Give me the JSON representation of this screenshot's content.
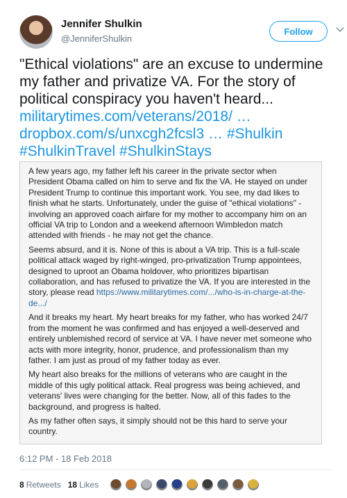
{
  "user": {
    "name": "Jennifer Shulkin",
    "handle": "@JenniferShulkin"
  },
  "follow_label": "Follow",
  "tweet": {
    "text_before": "\"Ethical violations\" are an excuse to undermine my father and privatize VA. For the story of political conspiracy you haven't heard... ",
    "link1": "militarytimes.com/veterans/2018/ …",
    "link2": "dropbox.com/s/unxcgh2fcsl3 …",
    "hashtag1": "#Shulkin",
    "hashtag2": "#ShulkinTravel",
    "hashtag3": "#ShulkinStays"
  },
  "card": {
    "p1": "A few years ago, my father left his career in the private sector when President Obama called on him to serve and fix the VA. He stayed on under President Trump to continue this important work. You see, my dad likes to finish what he starts. Unfortunately, under the guise of \"ethical violations\" - involving an approved coach airfare for my mother to accompany him on an official VA trip to London and a weekend afternoon Wimbledon match attended with friends - he may not get the chance.",
    "p2": "Seems absurd, and it is. None of this is about a VA trip. This is a full-scale political attack waged by right-winged, pro-privatization Trump appointees, designed to uproot an Obama holdover, who prioritizes bipartisan collaboration, and has refused to privatize the VA. If you are interested in the story, please read ",
    "p2_link": "https://www.militarytimes.com/.../who-is-in-charge-at-the-de.../",
    "p3": "And it breaks my heart. My heart breaks for my father, who has worked 24/7 from the moment he was confirmed and has enjoyed a well-deserved and entirely unblemished record of service at VA. I have never met someone who acts with more integrity, honor, prudence, and professionalism than my father. I am just as proud of my father today as ever.",
    "p4": "My heart also breaks for the millions of veterans who are caught in the middle of this ugly political attack. Real progress was being achieved, and veterans' lives were changing for the better. Now, all of this fades to the background, and progress is halted.",
    "p5": "As my father often says, it simply should not be this hard to serve your country."
  },
  "timestamp": "6:12 PM - 18 Feb 2018",
  "stats": {
    "retweets_count": "8",
    "retweets_label": "Retweets",
    "likes_count": "18",
    "likes_label": "Likes"
  },
  "colors": {
    "link": "#1b95e0",
    "follow": "#1da1f2"
  },
  "icons": [
    "chevron-down-icon"
  ],
  "liker_avatars": [
    "#6b4a2e",
    "#c9762f",
    "#b0b6bb",
    "#3b4a6b",
    "#2a3f8a",
    "#e0a33a",
    "#3b3b3b",
    "#555e6a",
    "#7a5a3a",
    "#d8b23a"
  ]
}
